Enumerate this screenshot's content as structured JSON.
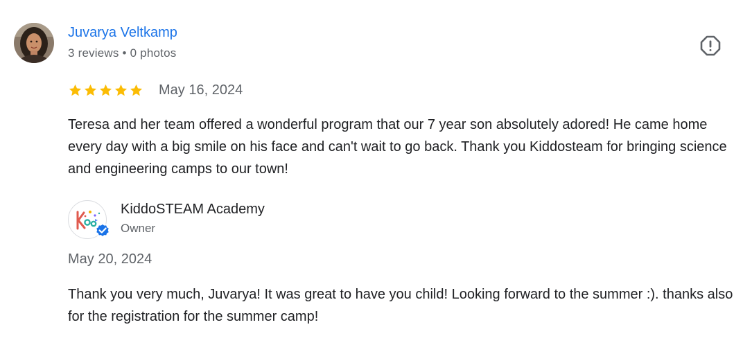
{
  "review": {
    "reviewer_name": "Juvarya Veltkamp",
    "reviewer_meta": "3 reviews • 0 photos",
    "rating": 5,
    "date": "May 16, 2024",
    "text": "Teresa and her team offered a wonderful program that our 7 year son absolutely adored! He came home every day with a big smile on his face and can't wait to go back. Thank you Kiddosteam for bringing science and engineering camps to our town!",
    "report_icon": "report-flag-icon"
  },
  "owner_reply": {
    "owner_name": "KiddoSTEAM Academy",
    "owner_role": "Owner",
    "date": "May 20, 2024",
    "text": "Thank you very much, Juvarya! It was great to have you child! Looking forward to the summer :). thanks also for the registration for the summer camp!",
    "badge_icon": "verified-badge-icon"
  },
  "colors": {
    "name_link": "#1a73e8",
    "star": "#fbbc04",
    "secondary_text": "#5f6368",
    "verified": "#1a73e8"
  }
}
